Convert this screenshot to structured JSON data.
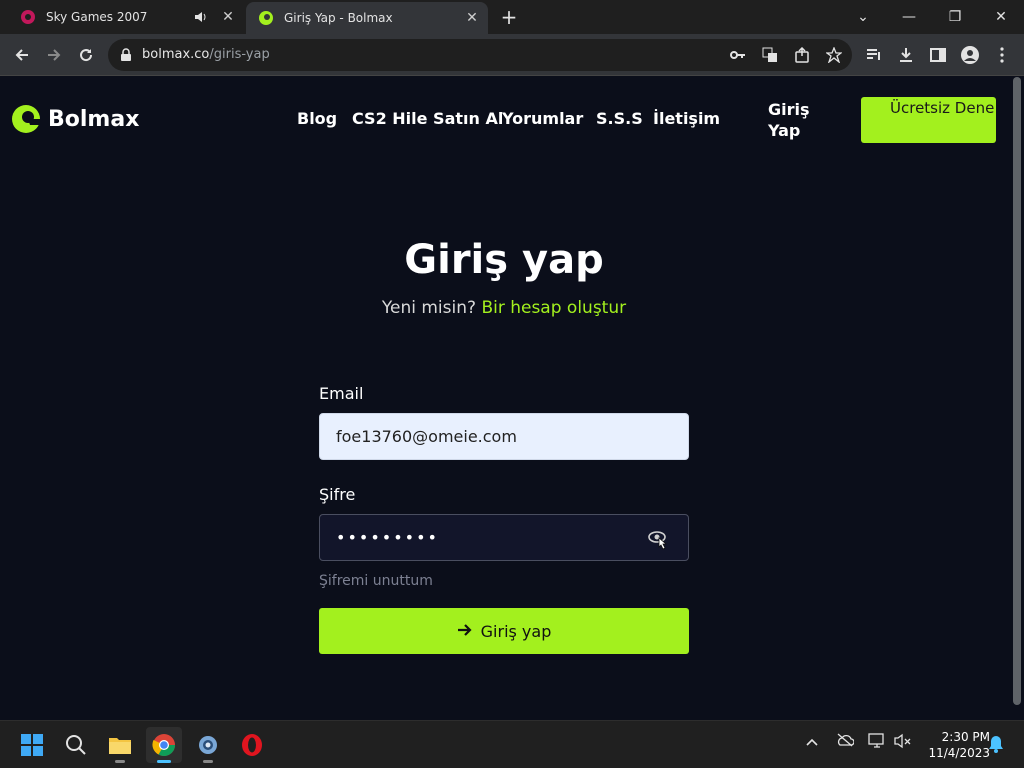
{
  "browser": {
    "tabs": [
      {
        "title": "Sky Games 2007",
        "icon": "sky-games-favicon",
        "audio": true
      },
      {
        "title": "Giriş Yap - Bolmax",
        "icon": "bolmax-favicon",
        "active": true
      }
    ],
    "url_host": "bolmax.co",
    "url_path": "/giris-yap"
  },
  "site": {
    "brand": "Bolmax",
    "nav": [
      "Blog",
      "CS2 Hile Satın Al",
      "Yorumlar",
      "S.S.S",
      "İletişim"
    ],
    "login_link": "Giriş Yap",
    "cta": "Ücretsiz Dene",
    "accent_color": "#a3f01e"
  },
  "login": {
    "title": "Giriş yap",
    "subtitle_prefix": "Yeni misin?",
    "subtitle_link": "Bir hesap oluştur",
    "email_label": "Email",
    "email_value": "foe13760@omeie.com",
    "password_label": "Şifre",
    "password_value": "•••••••••",
    "forgot": "Şifremi unuttum",
    "submit": "Giriş yap"
  },
  "taskbar": {
    "time": "2:30 PM",
    "date": "11/4/2023"
  }
}
